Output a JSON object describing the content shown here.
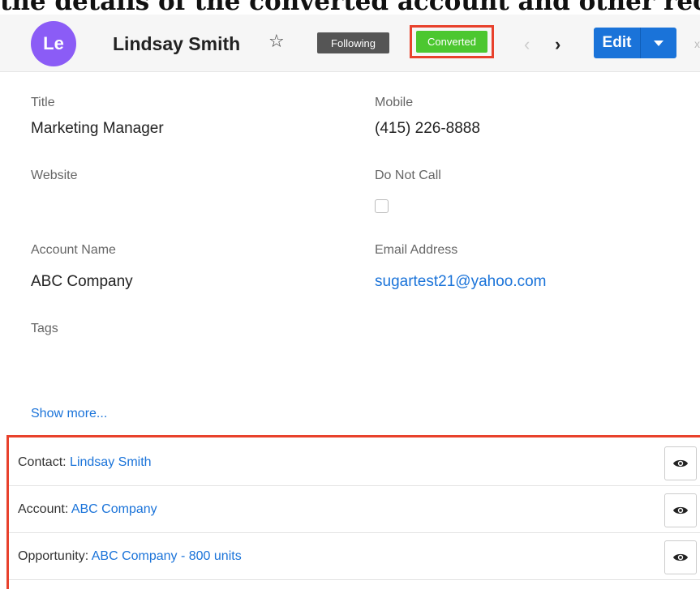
{
  "caption": "the details of the converted account and other recor",
  "header": {
    "avatar_initials": "Le",
    "record_name": "Lindsay Smith",
    "following_label": "Following",
    "converted_label": "Converted",
    "edit_label": "Edit",
    "edge_text": "x"
  },
  "fields": {
    "title_label": "Title",
    "title_value": "Marketing Manager",
    "mobile_label": "Mobile",
    "mobile_value": "(415) 226-8888",
    "website_label": "Website",
    "do_not_call_label": "Do Not Call",
    "account_name_label": "Account Name",
    "account_name_value": "ABC Company",
    "email_label": "Email Address",
    "email_value": "sugartest21@yahoo.com",
    "tags_label": "Tags",
    "show_more": "Show more..."
  },
  "related": [
    {
      "prefix": "Contact:",
      "link": "Lindsay Smith"
    },
    {
      "prefix": "Account:",
      "link": "ABC Company"
    },
    {
      "prefix": "Opportunity:",
      "link": "ABC Company - 800 units"
    }
  ],
  "icons": {
    "star": "star-outline",
    "prev": "chevron-left",
    "next": "chevron-right",
    "dropdown": "caret-down",
    "preview": "eye"
  },
  "colors": {
    "accent": "#1a73d9",
    "converted": "#4cc730",
    "highlight": "#e8412c",
    "avatar": "#8b5cf6"
  }
}
